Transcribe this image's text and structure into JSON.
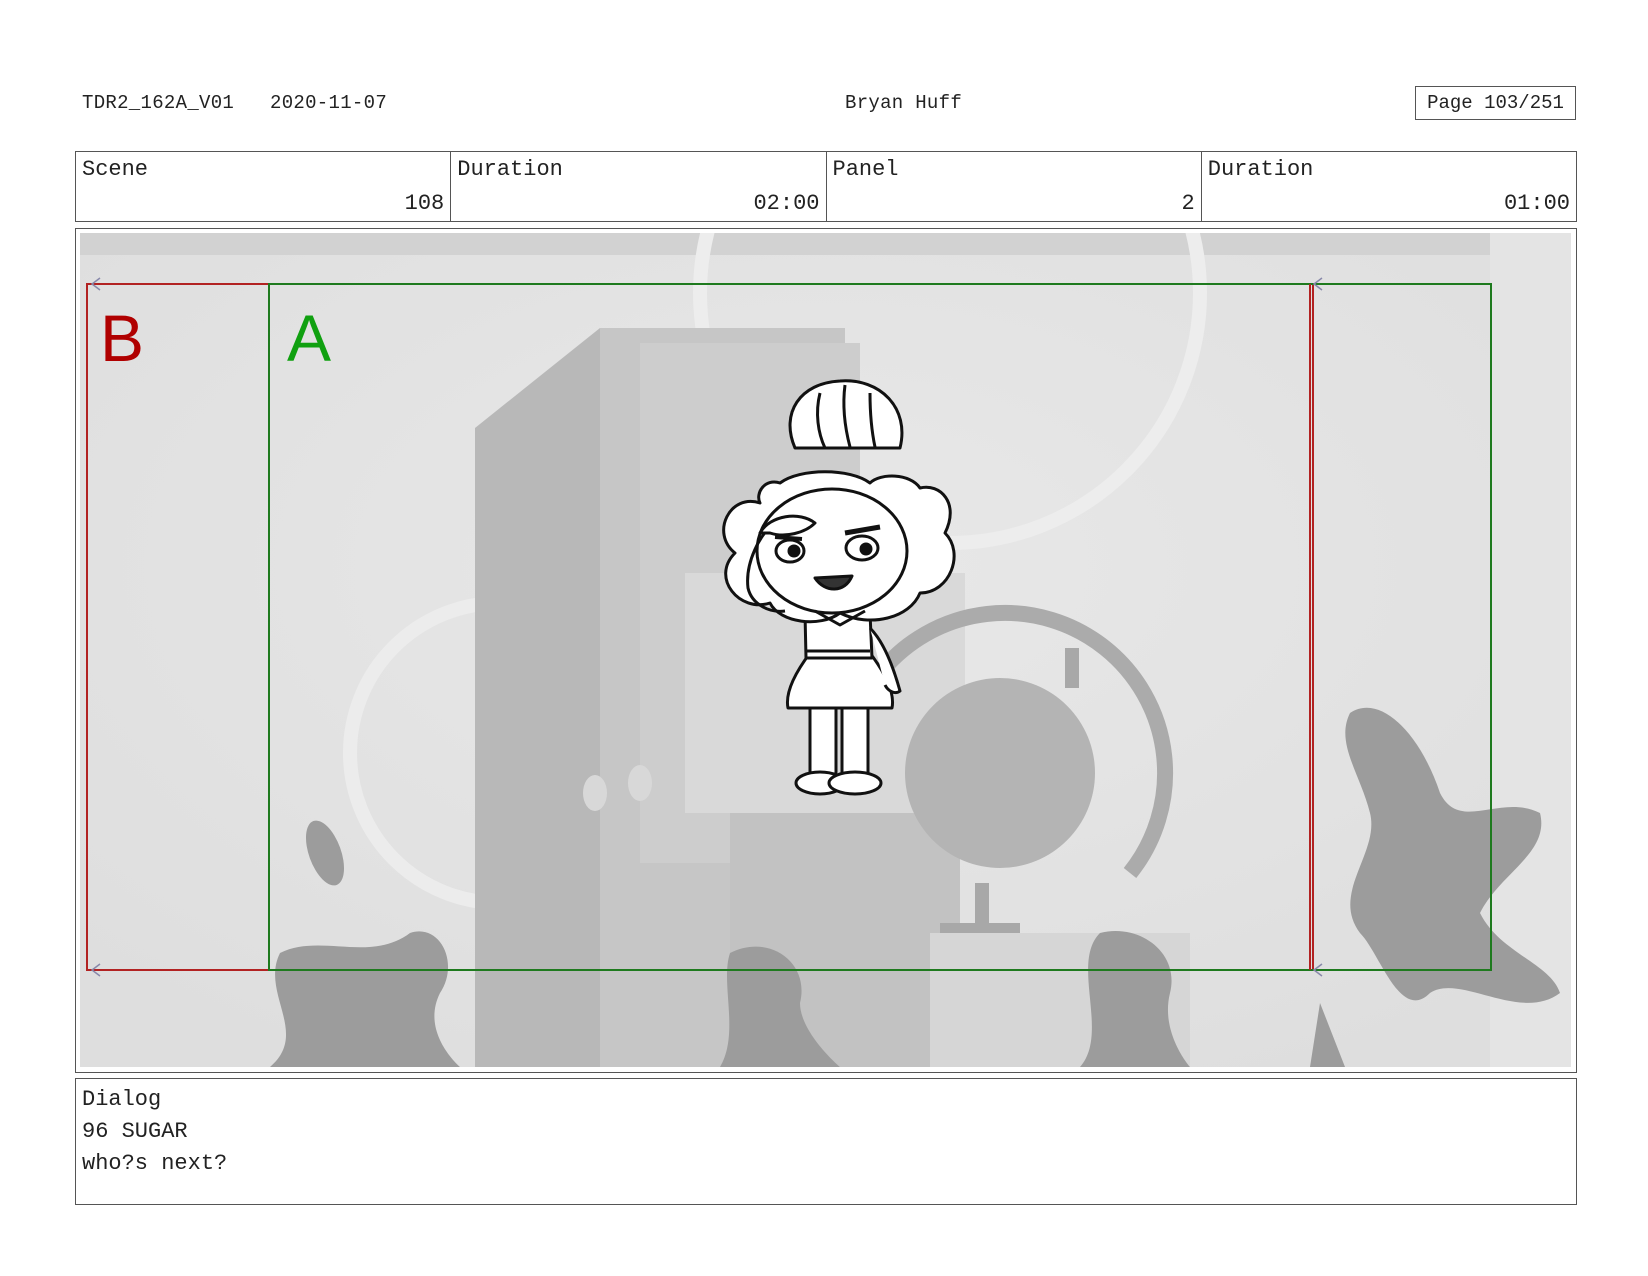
{
  "header": {
    "project_id": "TDR2_162A_V01",
    "date": "2020-11-07",
    "artist": "Bryan Huff",
    "page": "Page 103/251"
  },
  "info": {
    "scene_label": "Scene",
    "scene_value": "108",
    "scene_duration_label": "Duration",
    "scene_duration_value": "02:00",
    "panel_label": "Panel",
    "panel_value": "2",
    "panel_duration_label": "Duration",
    "panel_duration_value": "01:00"
  },
  "panel": {
    "field_b": "B",
    "field_a": "A",
    "field_b_color": "#b00000",
    "field_a_color": "#10a010"
  },
  "dialog": {
    "title": "Dialog",
    "character": "96 SUGAR",
    "line": "who?s next?"
  }
}
